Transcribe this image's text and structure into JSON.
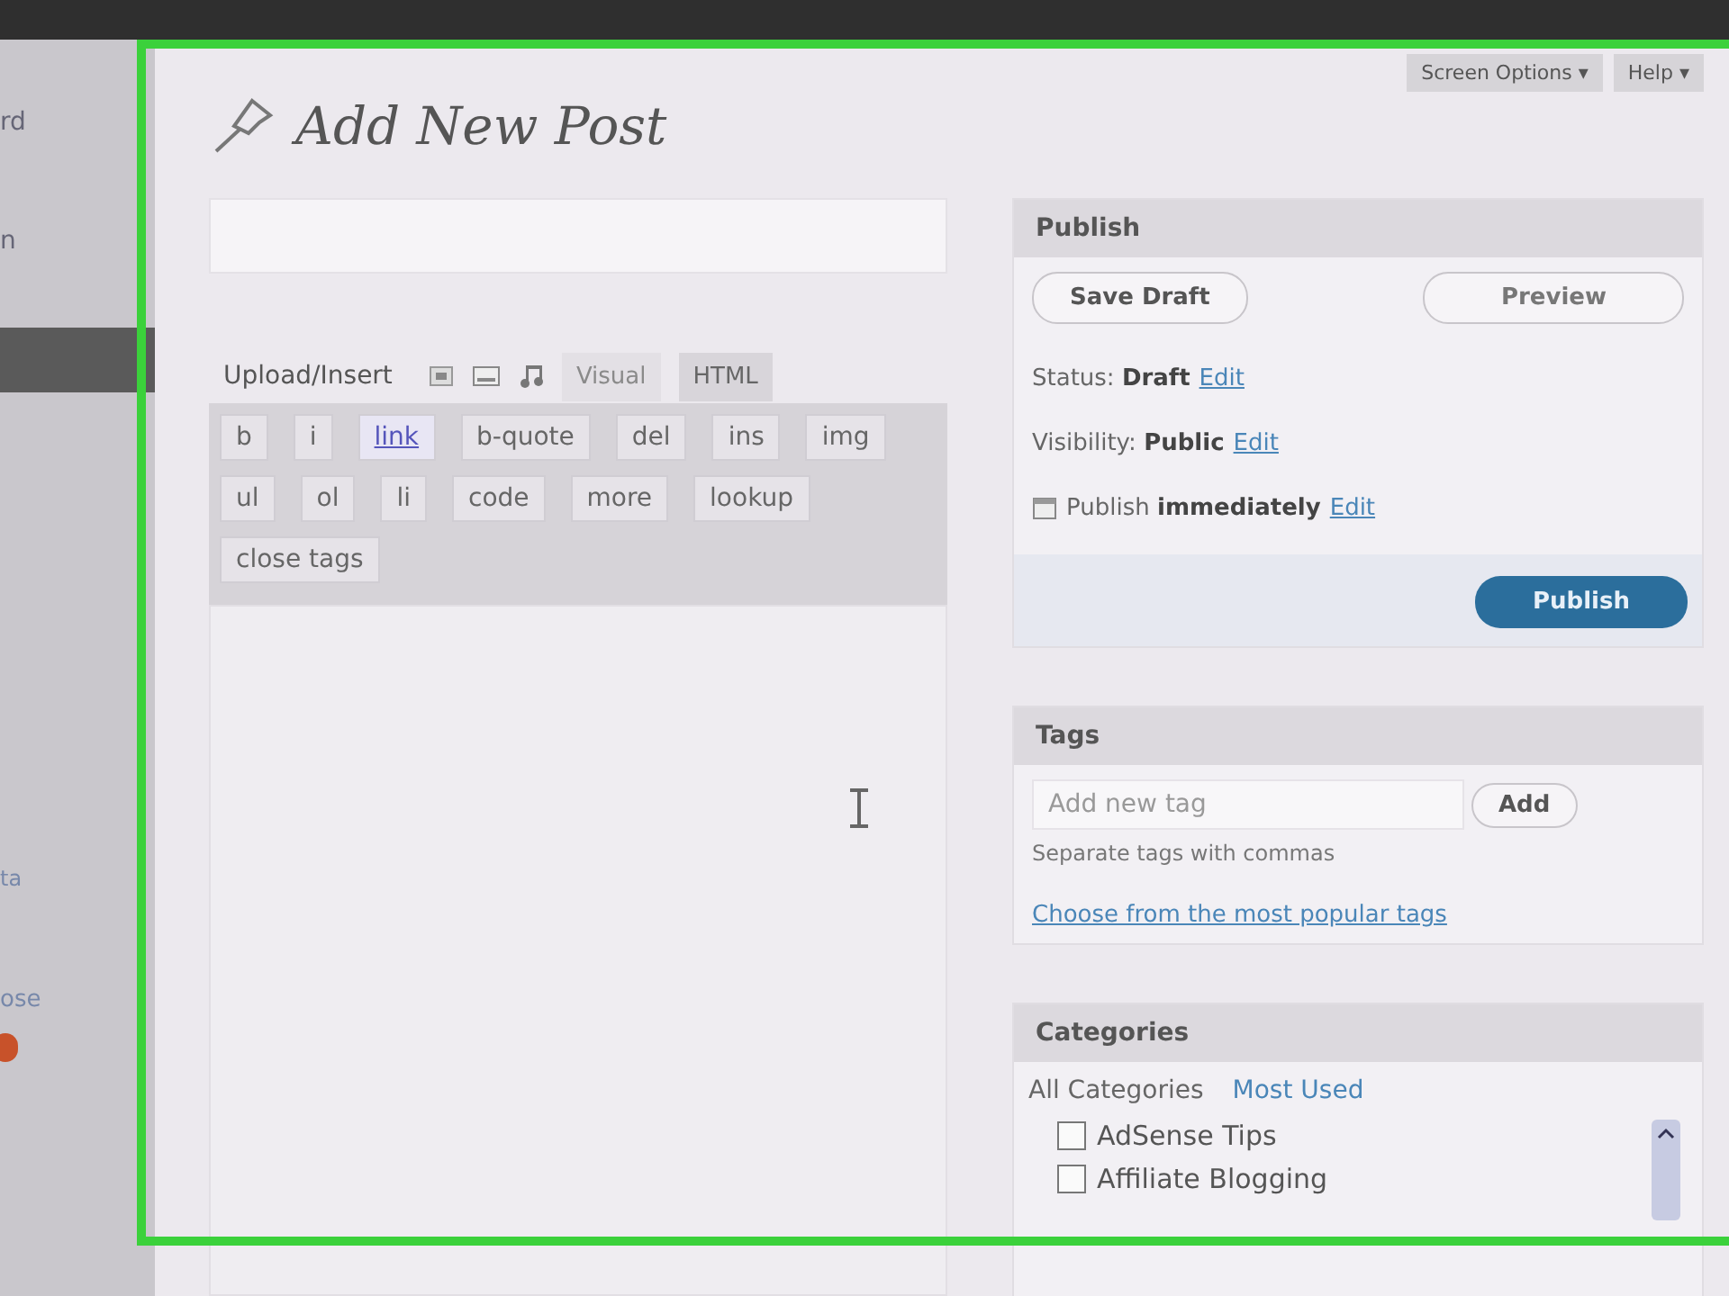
{
  "sidebar": {
    "items": [
      {
        "label": "rd",
        "selected": false
      },
      {
        "label": "n",
        "selected": false
      },
      {
        "selected": true
      },
      {
        "label": "ta",
        "selected": false
      },
      {
        "label": "ose",
        "selected": false
      }
    ]
  },
  "header": {
    "title": "Add New Post",
    "buttons": [
      {
        "label": "Screen Options ▾"
      },
      {
        "label": "Help ▾"
      }
    ]
  },
  "editor": {
    "upload_label": "Upload/Insert",
    "tabs": [
      {
        "label": "Visual",
        "selected": false
      },
      {
        "label": "HTML",
        "selected": true
      }
    ],
    "quicktags": [
      {
        "label": "b",
        "highlighted": false
      },
      {
        "label": "i",
        "highlighted": false
      },
      {
        "label": "link",
        "highlighted": true
      },
      {
        "label": "b-quote",
        "highlighted": false
      },
      {
        "label": "del",
        "highlighted": false
      },
      {
        "label": "ins",
        "highlighted": false
      },
      {
        "label": "img",
        "highlighted": false
      },
      {
        "label": "ul",
        "highlighted": false
      },
      {
        "label": "ol",
        "highlighted": false
      },
      {
        "label": "li",
        "highlighted": false
      },
      {
        "label": "code",
        "highlighted": false
      },
      {
        "label": "more",
        "highlighted": false
      },
      {
        "label": "lookup",
        "highlighted": false
      },
      {
        "label": "close tags",
        "highlighted": false
      }
    ]
  },
  "publish": {
    "title": "Publish",
    "save_draft": "Save Draft",
    "preview": "Preview",
    "rows": [
      {
        "label": "Status:",
        "value": "Draft",
        "link": "Edit"
      },
      {
        "label": "Visibility:",
        "value": "Public",
        "link": "Edit"
      },
      {
        "label": "Publish",
        "value": "immediately",
        "link": "Edit"
      }
    ],
    "publish_button": "Publish"
  },
  "tags": {
    "title": "Tags",
    "placeholder": "Add new tag",
    "add_button": "Add",
    "hint": "Separate tags with commas",
    "link": "Choose from the most popular tags"
  },
  "categories": {
    "title": "Categories",
    "tabs": [
      {
        "label": "All Categories",
        "selected": true
      },
      {
        "label": "Most Used",
        "selected": false
      }
    ],
    "items": [
      {
        "label": "AdSense Tips",
        "checked": false
      },
      {
        "label": "Affiliate Blogging",
        "checked": false
      }
    ]
  }
}
